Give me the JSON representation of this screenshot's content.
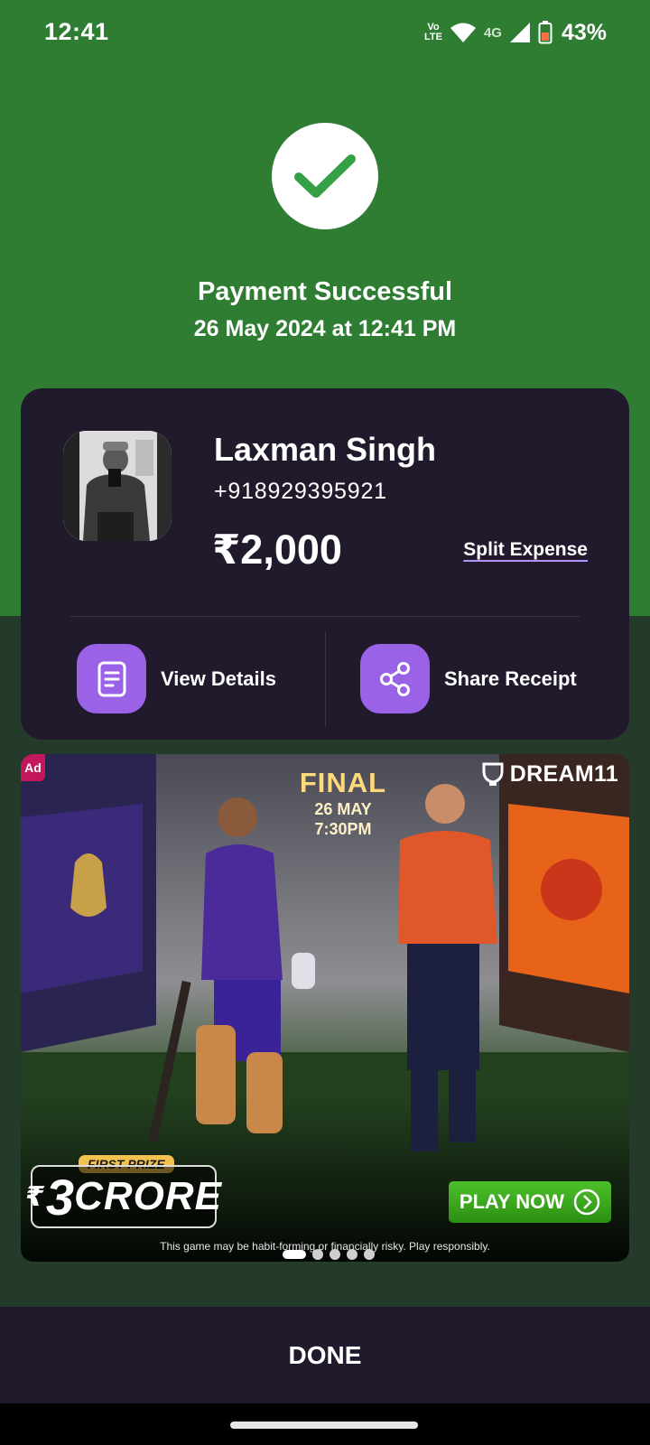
{
  "status_bar": {
    "time": "12:41",
    "volte_top": "Vo",
    "volte_bottom": "LTE",
    "network": "4G",
    "battery": "43%"
  },
  "header": {
    "title": "Payment Successful",
    "datetime": "26 May 2024 at 12:41 PM"
  },
  "payee": {
    "name": "Laxman Singh",
    "phone": "+918929395921",
    "amount": "₹2,000",
    "split_label": "Split Expense"
  },
  "actions": {
    "view_details": "View Details",
    "share_receipt": "Share Receipt"
  },
  "ad": {
    "badge": "Ad",
    "brand": "DREAM11",
    "final_title": "FINAL",
    "final_date": "26 MAY",
    "final_time": "7:30PM",
    "first_prize_label": "FIRST PRIZE",
    "prize_symbol": "₹",
    "prize_number": "3",
    "prize_word": "CRORE",
    "cta": "PLAY NOW",
    "disclaimer": "This game may be habit-forming or financially risky. Play responsibly.",
    "carousel_total": 5,
    "carousel_active": 1
  },
  "footer": {
    "done_label": "DONE"
  },
  "colors": {
    "success_green": "#2f7d32",
    "card_bg": "#211a2d",
    "accent_purple": "#9a62e6",
    "cta_green": "#3aa51f"
  }
}
